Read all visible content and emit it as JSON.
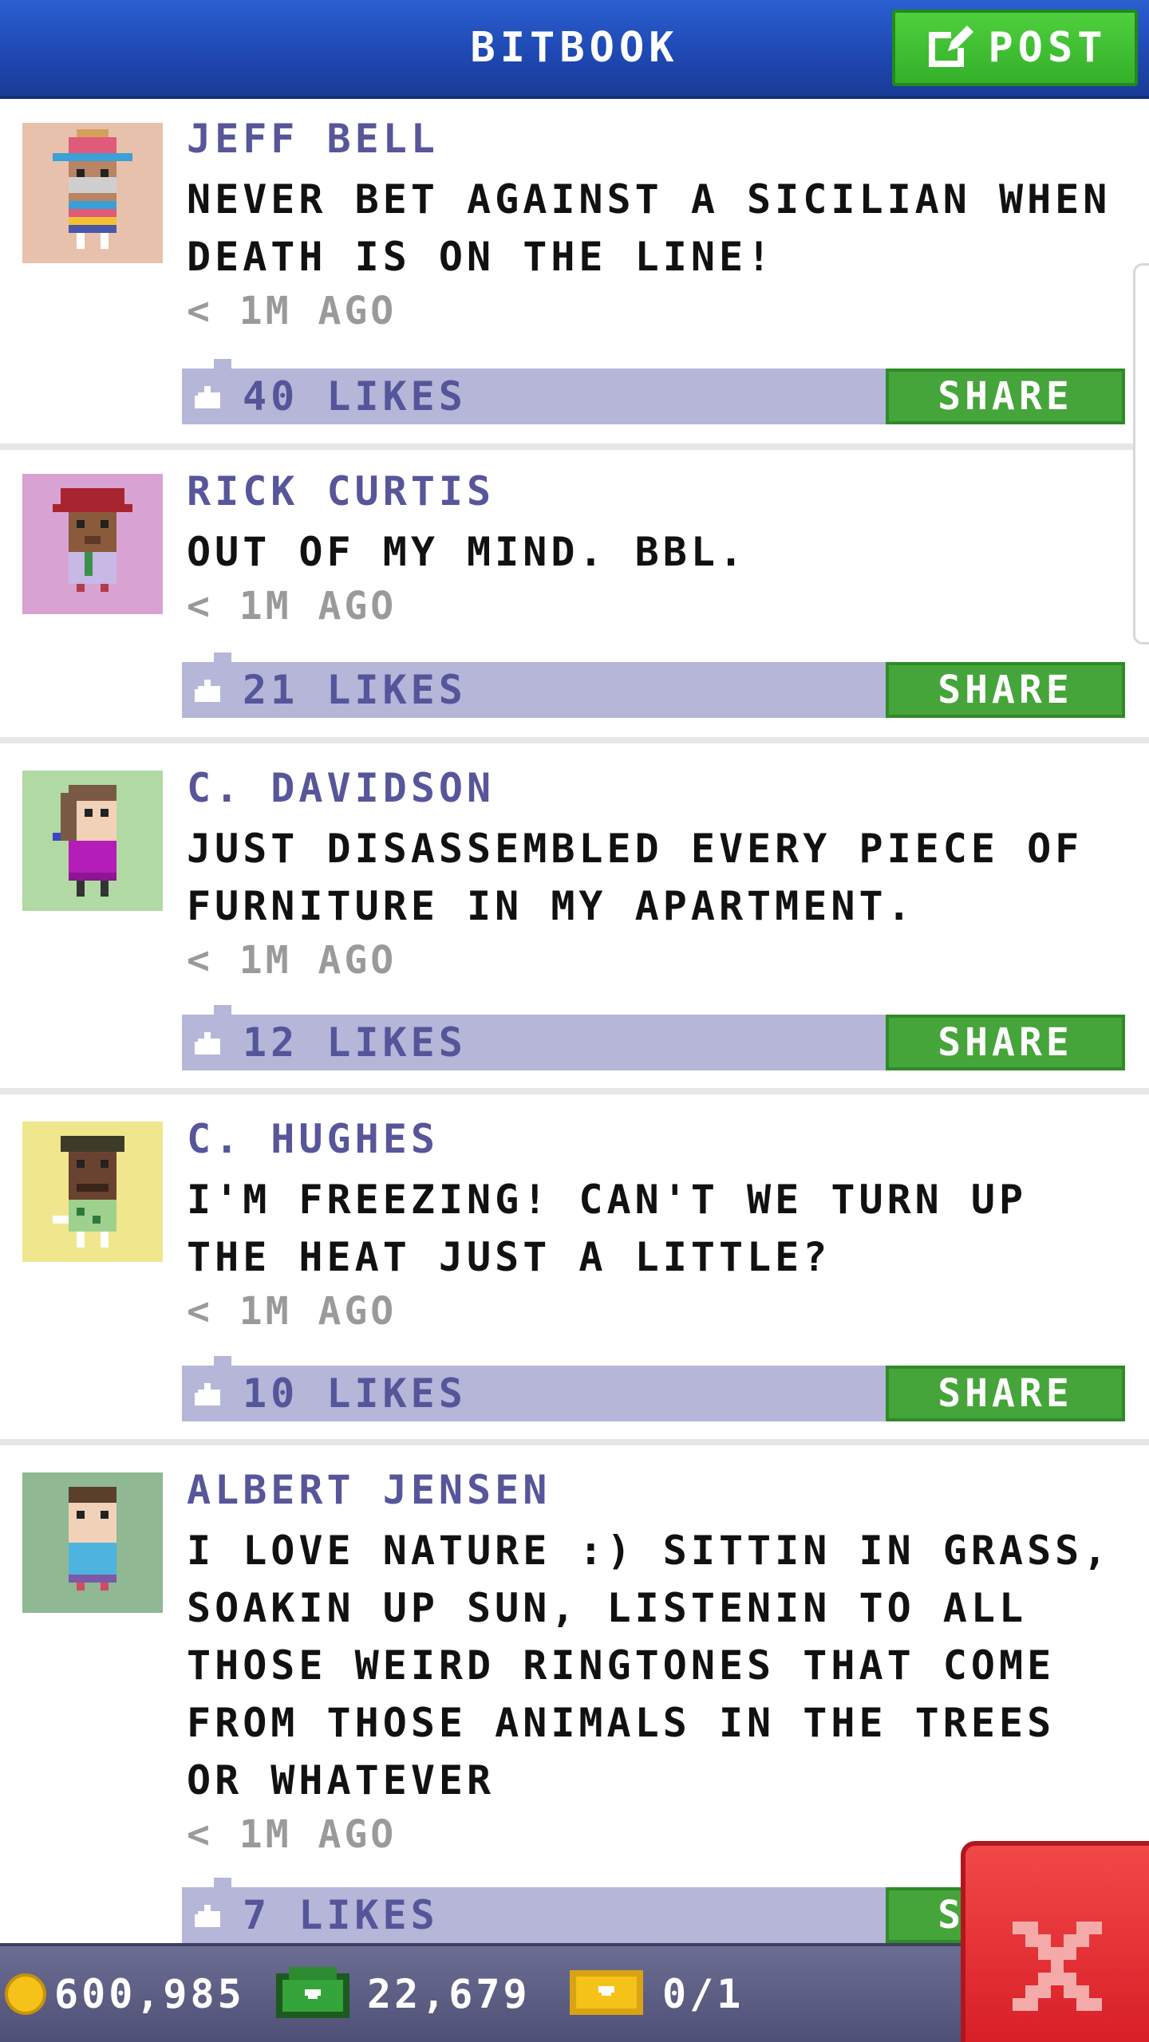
{
  "header": {
    "title": "BITBOOK",
    "post_label": "POST"
  },
  "posts": [
    {
      "author": "JEFF BELL",
      "message": "NEVER BET AGAINST A SICILIAN WHEN DEATH IS ON THE LINE!",
      "time": "< 1M AGO",
      "likes": "40 LIKES",
      "share": "SHARE",
      "avatar_bg": "#e8c1ad"
    },
    {
      "author": "RICK CURTIS",
      "message": "OUT OF MY MIND. BBL.",
      "time": "< 1M AGO",
      "likes": "21 LIKES",
      "share": "SHARE",
      "avatar_bg": "#d8a3d2"
    },
    {
      "author": "C. DAVIDSON",
      "message": "JUST DISASSEMBLED EVERY PIECE OF FURNITURE IN MY APARTMENT.",
      "time": "< 1M AGO",
      "likes": "12 LIKES",
      "share": "SHARE",
      "avatar_bg": "#b1d9a3"
    },
    {
      "author": "C. HUGHES",
      "message": "I'M FREEZING! CAN'T WE TURN UP THE HEAT JUST A LITTLE?",
      "time": "< 1M AGO",
      "likes": "10 LIKES",
      "share": "SHARE",
      "avatar_bg": "#f0e68e"
    },
    {
      "author": "ALBERT JENSEN",
      "message": "I LOVE NATURE :) SITTIN IN GRASS, SOAKIN UP SUN, LISTENIN TO ALL THOSE WEIRD RINGTONES THAT COME FROM THOSE ANIMALS IN THE TREES OR WHATEVER",
      "time": "< 1M AGO",
      "likes": "7 LIKES",
      "share": "SHARE",
      "avatar_bg": "#8fb893"
    }
  ],
  "status": {
    "coins": "600,985",
    "bux": "22,679",
    "tickets": "0/1"
  },
  "colors": {
    "header_blue": "#1e47b0",
    "post_green": "#3fbf33",
    "author_purple": "#57569a",
    "likes_bar": "#b5b6d8",
    "share_green": "#45a53a",
    "close_red": "#e0262d"
  },
  "icons": [
    "edit-icon",
    "like-icon",
    "coin-icon",
    "bux-icon",
    "ticket-icon",
    "close-icon"
  ]
}
